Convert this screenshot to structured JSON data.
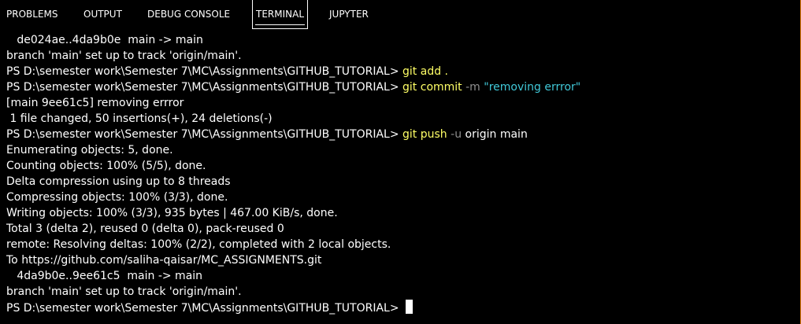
{
  "tabs": [
    {
      "label": "PROBLEMS"
    },
    {
      "label": "OUTPUT"
    },
    {
      "label": "DEBUG CONSOLE"
    },
    {
      "label": "TERMINAL"
    },
    {
      "label": "JUPYTER"
    }
  ],
  "active_tab": "TERMINAL",
  "colors": {
    "background": "#000000",
    "text": "#ffffff",
    "command": "#ffff66",
    "flag": "#8f8f8f",
    "string": "#40c8d8",
    "panel_border": "#e07a0a"
  },
  "terminal": {
    "prompt": "PS D:\\semester work\\Semester 7\\MC\\Assignments\\GITHUB_TUTORIAL> ",
    "lines": {
      "l0": "   de024ae..4da9b0e  main -> main",
      "l1": "branch 'main' set up to track 'origin/main'.",
      "l2_cmd": "git add .",
      "l3_cmd": "git commit",
      "l3_flag": "-m",
      "l3_str": "\"removing errror\"",
      "l4": "[main 9ee61c5] removing errror",
      "l5": " 1 file changed, 50 insertions(+), 24 deletions(-)",
      "l6_cmd": "git push",
      "l6_flag": "-u",
      "l6_rest": "origin main",
      "l7": "Enumerating objects: 5, done.",
      "l8": "Counting objects: 100% (5/5), done.",
      "l9": "Delta compression using up to 8 threads",
      "l10": "Compressing objects: 100% (3/3), done.",
      "l11": "Writing objects: 100% (3/3), 935 bytes | 467.00 KiB/s, done.",
      "l12": "Total 3 (delta 2), reused 0 (delta 0), pack-reused 0",
      "l13": "remote: Resolving deltas: 100% (2/2), completed with 2 local objects.",
      "l14": "To https://github.com/saliha-qaisar/MC_ASSIGNMENTS.git",
      "l15": "   4da9b0e..9ee61c5  main -> main",
      "l16": "branch 'main' set up to track 'origin/main'."
    }
  }
}
